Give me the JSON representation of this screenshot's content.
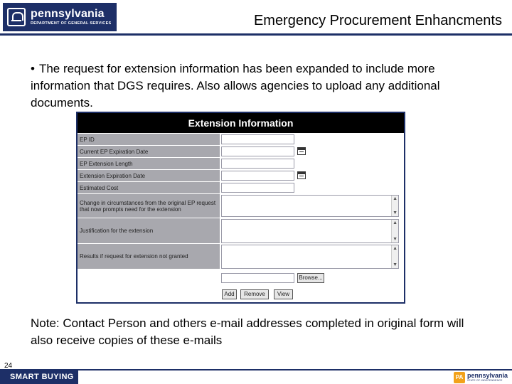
{
  "header": {
    "logo": {
      "title": "pennsylvania",
      "subtitle": "DEPARTMENT OF GENERAL SERVICES"
    },
    "slide_title": "Emergency Procurement Enhancments"
  },
  "body": {
    "bullet_glyph": "•",
    "bullet_text": "The request for extension information has been expanded to include more information that DGS requires. Also allows agencies to upload any additional documents."
  },
  "form_screenshot": {
    "title": "Extension Information",
    "fields": [
      {
        "label": "EP ID",
        "type": "text"
      },
      {
        "label": "Current EP Expiration Date",
        "type": "date"
      },
      {
        "label": "EP Extension Length",
        "type": "text"
      },
      {
        "label": "Extension Expiration Date",
        "type": "date"
      },
      {
        "label": "Estimated Cost",
        "type": "text"
      },
      {
        "label": "Change in circumstances from the original EP request that now prompts need for the extension",
        "type": "textarea"
      },
      {
        "label": "Justification for the extension",
        "type": "textarea"
      },
      {
        "label": "Results if request for extension not granted",
        "type": "textarea"
      }
    ],
    "upload": {
      "browse_label": "Browse...",
      "add_label": "Add",
      "remove_label": "Remove",
      "view_label": "View"
    }
  },
  "note": {
    "text": "Note: Contact Person and others e-mail addresses completed in original form will also receive copies of these e-mails"
  },
  "footer": {
    "page_number": "24",
    "left_label": "SMART BUYING",
    "right_logo": {
      "badge": "PA",
      "title": "pennsylvania",
      "subtitle": "STATE OF INDEPENDENCE"
    }
  },
  "colors": {
    "brand_navy": "#1d2f67",
    "label_gray": "#a8a8ae",
    "pa_orange": "#f2a21b"
  }
}
